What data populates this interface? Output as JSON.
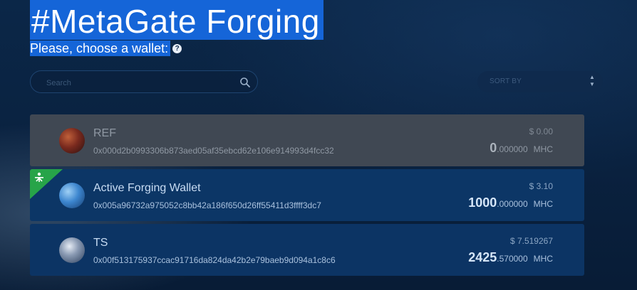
{
  "header": {
    "title": "#MetaGate Forging",
    "subtitle": "Please, choose a wallet:"
  },
  "controls": {
    "search_placeholder": "Search",
    "sort_label": "SORT BY"
  },
  "wallets": [
    {
      "name": "REF",
      "address": "0x000d2b0993306b873aed05af35ebcd62e106e914993d4fcc32",
      "usd": "$ 0.00",
      "amount_int": "0",
      "amount_dec": ".000000",
      "currency": "MHC",
      "state": "inactive",
      "avatar_colors": [
        "#b04a2c",
        "#3a1a1a"
      ]
    },
    {
      "name": "Active Forging Wallet",
      "address": "0x005a96732a975052c8bb42a186f650d26ff55411d3ffff3dc7",
      "usd": "$ 3.10",
      "amount_int": "1000",
      "amount_dec": ".000000",
      "currency": "MHC",
      "state": "active",
      "forging_badge": true,
      "avatar_colors": [
        "#6fb0e8",
        "#1c4f8c"
      ]
    },
    {
      "name": "TS",
      "address": "0x00f513175937ccac91716da824da42b2e79baeb9d094a1c8c6",
      "usd": "$ 7.519267",
      "amount_int": "2425",
      "amount_dec": ".570000",
      "currency": "MHC",
      "state": "normal",
      "avatar_colors": [
        "#c9d4e4",
        "#2c3f5c"
      ]
    }
  ],
  "colors": {
    "highlight": "#1565d8",
    "forging_badge": "#27a449",
    "background": "#0a2240"
  },
  "icons": {
    "help": "question-circle-icon",
    "search": "search-icon",
    "sort": "sort-arrows-icon",
    "forging": "forging-icon"
  }
}
